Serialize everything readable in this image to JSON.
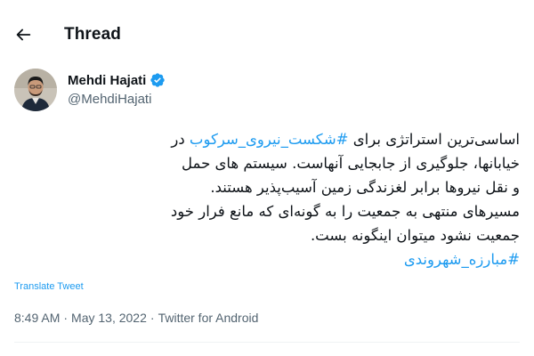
{
  "header": {
    "title": "Thread",
    "back_icon": "arrow-left-icon"
  },
  "author": {
    "name": "Mehdi Hajati",
    "handle": "@MehdiHajati",
    "verified_icon": "verified-badge-icon",
    "verified_color": "#1d9bf0"
  },
  "tweet": {
    "lines": [
      {
        "before": "اساسی‌ترین استراتژی برای ",
        "hashtag": "#شکست_نیروی_سرکوب",
        "after": " در"
      },
      {
        "text": "خیابانها، جلوگیری از جابجایی آنهاست. سیستم های حمل"
      },
      {
        "text": "و نقل نیروها برابر لغزندگی زمین آسیب‌پذیر هستند."
      },
      {
        "text": "مسیرهای منتهی به جمعیت را به گونه‌ای که مانع فرار خود"
      },
      {
        "text": "جمعیت نشود میتوان اینگونه بست."
      },
      {
        "hashtag": "#مبارزه_شهروندی"
      }
    ],
    "translate_label": "Translate Tweet",
    "time": "8:49 AM",
    "separator": "·",
    "date": "May 13, 2022",
    "client": "Twitter for Android"
  },
  "colors": {
    "link": "#1d9bf0",
    "text": "#0f1419",
    "muted": "#536471",
    "divider": "#eff3f4"
  }
}
